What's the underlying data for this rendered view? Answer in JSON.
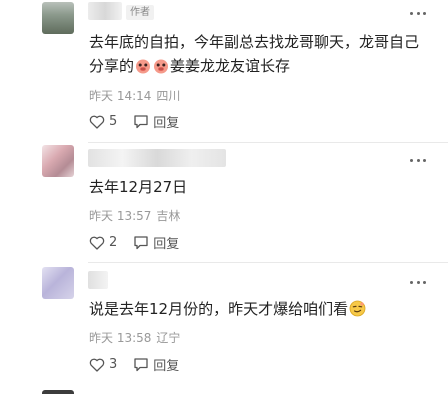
{
  "comments": [
    {
      "author_badge": "作者",
      "text_pre": "去年底的自拍，今年副总去找龙哥聊天，龙哥自己分享的",
      "emoji_1": "red-pig-face-emoji",
      "emoji_2": "red-pig-face-emoji",
      "text_post": "姜姜龙龙友谊长存",
      "time": "昨天 14:14",
      "location": "四川",
      "likes": "5",
      "reply_label": "回复"
    },
    {
      "text": "去年12月27日",
      "time": "昨天 13:57",
      "location": "吉林",
      "likes": "2",
      "reply_label": "回复"
    },
    {
      "text_pre": "说是去年12月份的，昨天才爆给咱们看",
      "emoji_1": "smirk-face-emoji",
      "time": "昨天 13:58",
      "location": "辽宁",
      "likes": "3",
      "reply_label": "回复"
    }
  ],
  "icons": {
    "like": "heart-outline-icon",
    "reply": "comment-bubble-icon",
    "more": "more-dots-icon"
  },
  "colors": {
    "text": "#222222",
    "meta": "#999999",
    "action": "#555555",
    "badge_bg": "#f1f1f1"
  }
}
